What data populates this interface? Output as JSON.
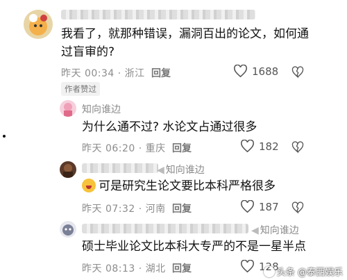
{
  "comments": [
    {
      "text_line1": "我看了，就那种错误，漏洞百出的论文，如何通",
      "text_line2": "过盲审的?",
      "time": "昨天 00:34 · 浙江",
      "reply": "回复",
      "likes": "1688",
      "badge": "作者赞过"
    },
    {
      "username": "知向谁边",
      "text": "为什么通不过? 水论文占通过很多",
      "time": "昨天 06:20 · 重庆",
      "reply": "回复",
      "likes": "182"
    },
    {
      "username": "知向谁边",
      "text": "可是研究生论文要比本科严格很多",
      "time": "昨天 07:32 · 河南",
      "reply": "回复",
      "likes": "187"
    },
    {
      "username": "知向谁边",
      "text": "硕士毕业论文比本科大专严的不是一星半点",
      "time": "昨天 08:13 · 湖北",
      "reply": "回复",
      "likes": "128"
    }
  ],
  "watermark": "头条 @泰西娱乐",
  "colors": {
    "text": "#111111",
    "meta": "#8c8c8c",
    "background": "#ffffff"
  },
  "icons": [
    "heart-outline-icon",
    "broken-heart-icon",
    "reply-arrow-icon",
    "laughing-emoji-icon"
  ]
}
